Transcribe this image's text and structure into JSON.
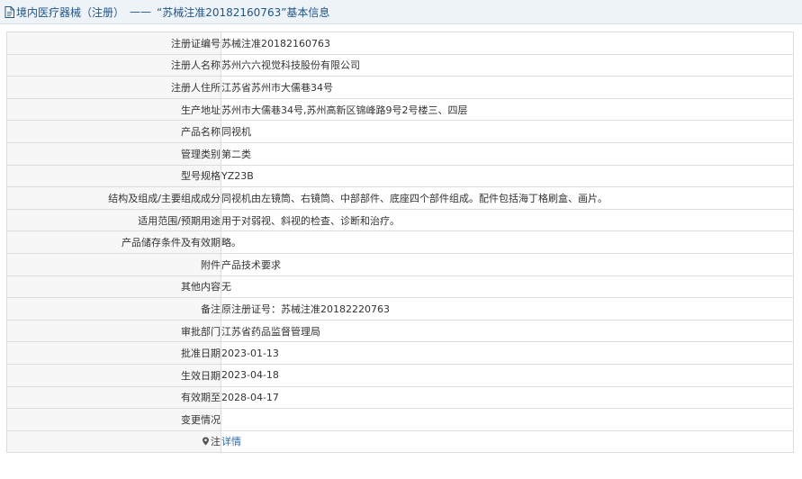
{
  "header": {
    "category": "境内医疗器械（注册）",
    "separator": "——",
    "title": "“苏械注准20182160763”基本信息"
  },
  "rows": [
    {
      "label": "注册证编号",
      "value": "苏械注准20182160763"
    },
    {
      "label": "注册人名称",
      "value": "苏州六六视觉科技股份有限公司"
    },
    {
      "label": "注册人住所",
      "value": "江苏省苏州市大儒巷34号"
    },
    {
      "label": "生产地址",
      "value": "苏州市大儒巷34号,苏州高新区锦峰路9号2号楼三、四层"
    },
    {
      "label": "产品名称",
      "value": "同视机"
    },
    {
      "label": "管理类别",
      "value": "第二类"
    },
    {
      "label": "型号规格",
      "value": "YZ23B"
    },
    {
      "label": "结构及组成/主要组成成分",
      "value": "同视机由左镜筒、右镜筒、中部部件、底座四个部件组成。配件包括海丁格刷盒、画片。"
    },
    {
      "label": "适用范围/预期用途",
      "value": "用于对弱视、斜视的检查、诊断和治疗。"
    },
    {
      "label": "产品储存条件及有效期",
      "value": "略。"
    },
    {
      "label": "附件",
      "value": "产品技术要求"
    },
    {
      "label": "其他内容",
      "value": "无"
    },
    {
      "label": "备注",
      "value": "原注册证号：苏械注准20182220763"
    },
    {
      "label": "审批部门",
      "value": "江苏省药品监督管理局"
    },
    {
      "label": "批准日期",
      "value": "2023-01-13"
    },
    {
      "label": "生效日期",
      "value": "2023-04-18"
    },
    {
      "label": "有效期至",
      "value": "2028-04-17"
    },
    {
      "label": "变更情况",
      "value": ""
    }
  ],
  "note": {
    "label": "注",
    "link_text": "详情",
    "icon": "pin-icon"
  },
  "colors": {
    "header_bg": "#eef3f8",
    "header_text": "#20558a",
    "label_bg": "#f7f7f7",
    "border": "#dddddd",
    "link": "#2a6ab8"
  }
}
